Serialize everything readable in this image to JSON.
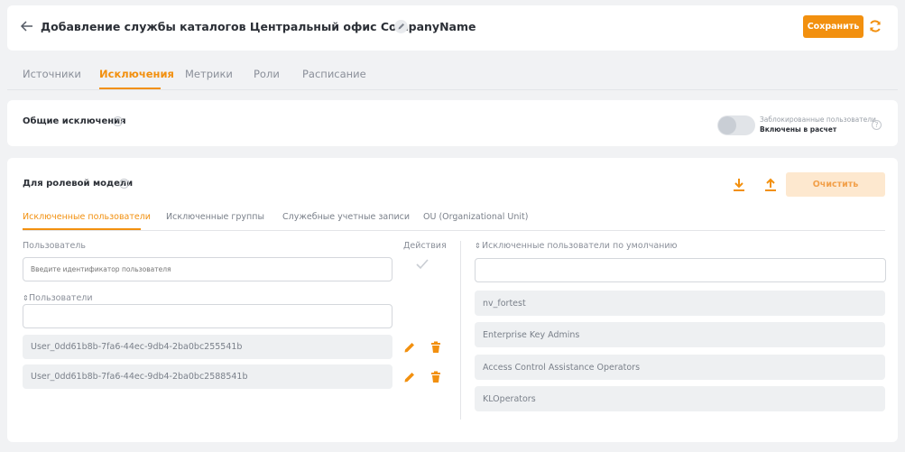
{
  "header": {
    "title": "Добавление службы каталогов Центральный офис CompanyName",
    "save_label": "Сохранить"
  },
  "tabs": [
    {
      "label": "Источники"
    },
    {
      "label": "Исключения"
    },
    {
      "label": "Метрики"
    },
    {
      "label": "Роли"
    },
    {
      "label": "Расписание"
    }
  ],
  "general": {
    "title": "Общие исключения",
    "toggle_label": "Заблокированные пользователи",
    "toggle_value": "Включены в расчет"
  },
  "role_model": {
    "title": "Для ролевой модели",
    "clear_label": "Очистить",
    "subtabs": [
      {
        "label": "Исключенные пользователи"
      },
      {
        "label": "Исключенные группы"
      },
      {
        "label": "Служебные учетные записи"
      },
      {
        "label": "OU (Organizational Unit)"
      }
    ],
    "user_label": "Пользователь",
    "user_placeholder": "Введите идентификатор пользователя",
    "actions_label": "Действия",
    "users_label": "Пользователи",
    "users": [
      {
        "name": "User_0dd61b8b-7fa6-44ec-9db4-2ba0bc255541b"
      },
      {
        "name": "User_0dd61b8b-7fa6-44ec-9db4-2ba0bc2588541b"
      }
    ],
    "default_label": "Исключенные пользователи по умолчанию",
    "default_users": [
      {
        "name": "nv_fortest"
      },
      {
        "name": "Enterprise Key Admins"
      },
      {
        "name": "Access Control Assistance Operators"
      },
      {
        "name": "KLOperators"
      }
    ]
  },
  "colors": {
    "accent": "#f2900f",
    "accent_light": "#fde8cf"
  }
}
